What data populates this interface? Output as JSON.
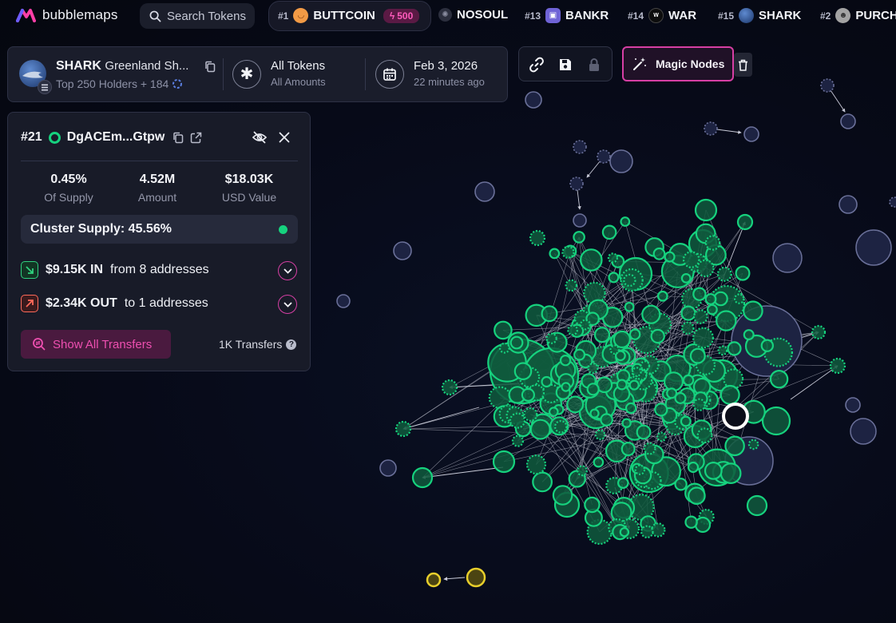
{
  "app": {
    "logo_text": "bubblemaps"
  },
  "search": {
    "label": "Search Tokens"
  },
  "trending": [
    {
      "rank": "#1",
      "name": "BUTTCOIN",
      "boost": "500",
      "icon": "butt-token-icon",
      "color": "#f29a45"
    },
    {
      "rank": "",
      "name": "NOSOUL",
      "icon": "nosoul-token-icon",
      "color": "#3a3d4d"
    },
    {
      "rank": "#13",
      "name": "BANKR",
      "icon": "bankr-token-icon",
      "color": "#6f63d6"
    },
    {
      "rank": "#14",
      "name": "WAR",
      "icon": "war-token-icon",
      "color": "#111111"
    },
    {
      "rank": "#15",
      "name": "SHARK",
      "icon": "shark-token-icon",
      "color": "#2a4f8f"
    },
    {
      "rank": "#2",
      "name": "PURCH",
      "icon": "purch-token-icon",
      "color": "#9b9b9b"
    }
  ],
  "token": {
    "symbol": "SHARK",
    "full_name": "Greenland Sh...",
    "holders_text": "Top 250 Holders + 184"
  },
  "filters": {
    "tokens_title": "All Tokens",
    "tokens_sub": "All Amounts",
    "date_title": "Feb 3, 2026",
    "date_sub": "22 minutes ago"
  },
  "tools": {
    "magic_nodes_label": "Magic Nodes"
  },
  "wallet": {
    "rank": "#21",
    "address": "DgACEm...Gtpw",
    "stats": [
      {
        "value": "0.45%",
        "label": "Of Supply"
      },
      {
        "value": "4.52M",
        "label": "Amount"
      },
      {
        "value": "$18.03K",
        "label": "USD Value"
      }
    ],
    "cluster_supply": "Cluster Supply: 45.56%",
    "in_amount": "$9.15K IN",
    "in_text": "from 8 addresses",
    "out_amount": "$2.34K OUT",
    "out_text": "to 1 addresses",
    "show_all_label": "Show All Transfers",
    "transfers_text": "1K Transfers"
  },
  "colors": {
    "accent": "#d63fa4",
    "cluster_green": "#16d27e",
    "node_navy": "#1d2342",
    "node_yellow": "#e8cf2b",
    "in_green": "#2fd17e",
    "out_red": "#ff6a5a"
  }
}
